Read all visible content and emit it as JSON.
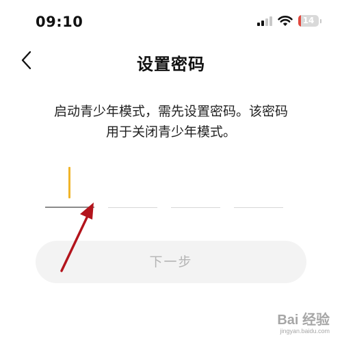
{
  "status_bar": {
    "time": "09:10",
    "battery_level": "14",
    "battery_fraction": 0.14,
    "icons": [
      "signal-icon",
      "wifi-icon",
      "battery-icon"
    ]
  },
  "header": {
    "title": "设置密码",
    "back_icon": "chevron-left-icon"
  },
  "description": {
    "line1": "启动青少年模式，需先设置密码。该密码",
    "line2": "用于关闭青少年模式。"
  },
  "password": {
    "length": 4,
    "filled": 0,
    "active_index": 0
  },
  "next_button": {
    "label": "下一步",
    "enabled": false
  },
  "watermark": {
    "main": "Bai 经验",
    "sub": "jingyan.baidu.com"
  },
  "colors": {
    "caret": "#f0b429",
    "annotation_arrow": "#b3141c",
    "battery_low": "#e0483e",
    "button_bg": "#f3f3f3",
    "button_text": "#b4b4b4"
  }
}
